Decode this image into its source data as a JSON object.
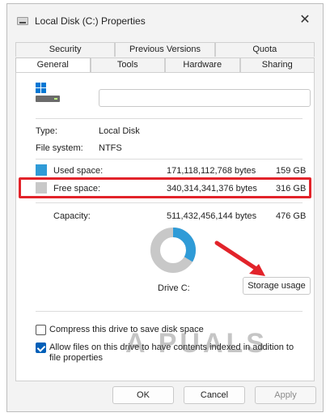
{
  "window": {
    "title": "Local Disk (C:) Properties",
    "close_glyph": "✕"
  },
  "tabs": {
    "top": [
      "Security",
      "Previous Versions",
      "Quota"
    ],
    "bottom": [
      "General",
      "Tools",
      "Hardware",
      "Sharing"
    ],
    "active": "General"
  },
  "drive": {
    "label_value": "",
    "icon": "drive-icon"
  },
  "info": {
    "type_label": "Type:",
    "type_value": "Local Disk",
    "fs_label": "File system:",
    "fs_value": "NTFS"
  },
  "usage": {
    "used": {
      "label": "Used space:",
      "bytes": "171,118,112,768 bytes",
      "gb": "159 GB",
      "color": "#2f9bd7"
    },
    "free": {
      "label": "Free space:",
      "bytes": "340,314,341,376 bytes",
      "gb": "316 GB",
      "color": "#c8c8c8"
    },
    "capacity": {
      "label": "Capacity:",
      "bytes": "511,432,456,144 bytes",
      "gb": "476 GB"
    },
    "used_fraction": 0.335
  },
  "drive_caption": "Drive C:",
  "storage_button": "Storage usage",
  "options": {
    "compress": {
      "label": "Compress this drive to save disk space",
      "checked": false
    },
    "index": {
      "label": "Allow files on this drive to have contents indexed in addition to file properties",
      "checked": true
    }
  },
  "watermark": "A PUALS",
  "footer": {
    "ok": "OK",
    "cancel": "Cancel",
    "apply": "Apply"
  },
  "colors": {
    "accent": "#005fb8",
    "highlight": "#e2232a"
  }
}
